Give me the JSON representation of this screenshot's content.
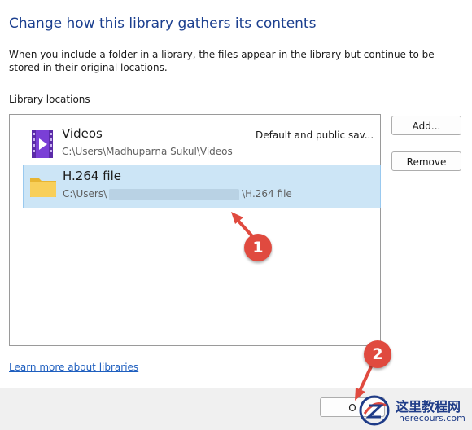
{
  "dialog": {
    "title": "Change how this library gathers its contents",
    "description": "When you include a folder in a library, the files appear in the library but continue to be stored in their original locations.",
    "section_label": "Library locations",
    "locations": [
      {
        "name": "Videos",
        "path": "C:\\Users\\Madhuparna Sukul\\Videos",
        "type": "Default and public sav...",
        "icon": "videos-library-icon",
        "selected": false
      },
      {
        "name": "H.264 file",
        "path_prefix": "C:\\Users\\",
        "path_suffix": "\\H.264 file",
        "icon": "folder-icon",
        "selected": true
      }
    ],
    "buttons": {
      "add": "Add...",
      "remove": "Remove",
      "ok": "O"
    },
    "learn_more": "Learn more about libraries"
  },
  "annotations": {
    "badge_1": "1",
    "badge_2": "2",
    "color": "#e04a3f"
  },
  "watermark": {
    "cn": "这里教程网",
    "en": "herecours.com"
  },
  "colors": {
    "title": "#1b3f8f",
    "selection_bg": "#cce5f6",
    "selection_border": "#99c9ef",
    "link": "#1f5fbf"
  }
}
